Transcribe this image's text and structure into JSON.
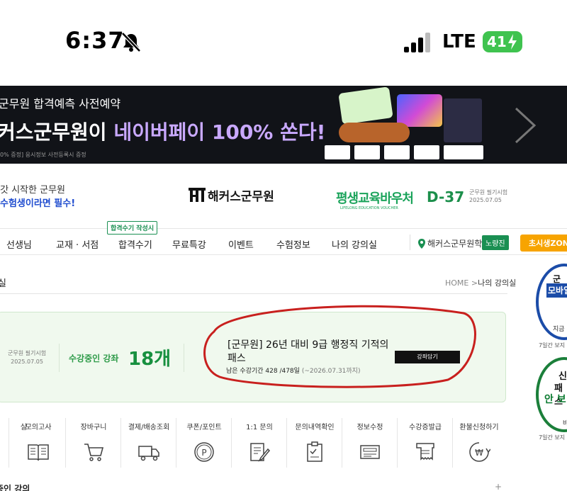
{
  "statusbar": {
    "time": "6:37",
    "network": "LTE",
    "battery": "41"
  },
  "banner": {
    "top_line": "군무원 합격예측 사전예약",
    "main_prefix": "커스군무원이 ",
    "main_highlight": "네이버페이 100% 쏜다!",
    "fine_print": "0% 증정] 응시정보 사전등록시 증정"
  },
  "header": {
    "tagline_1": "갓 시작한 군무원",
    "tagline_2": "수험생이라면 필수!",
    "logo_text": "해커스군무원",
    "voucher_title": "평생교육바우처",
    "voucher_sub": "LIFELONG EDUCATION VOUCHER",
    "dday": "D-37",
    "dday_info_1": "군무원 필기시험",
    "dday_info_2": "2025.07.05"
  },
  "nav": {
    "items": [
      "선생님",
      "교재 · 서점",
      "합격수기",
      "무료특강",
      "이벤트",
      "수험정보",
      "나의 강의실"
    ],
    "badge": "합격수기 작성시",
    "place": "해커스군무원학원",
    "place_button": "노량진",
    "zone_button": "초시생ZONE"
  },
  "page": {
    "title": "실",
    "breadcrumb_home": "HOME",
    "breadcrumb_sep": ">",
    "breadcrumb_current": "나의 강의실"
  },
  "summary": {
    "exam_label": "군무원 필기시험",
    "exam_date": "2025.07.05",
    "active_label": "수강중인 강좌",
    "active_count": "18개",
    "course_title": "[군무원] 26년 대비 9급 행정직 기적의 패스",
    "remain_label": "남은 수강기간 428 /478일",
    "remain_until": "(~2026.07.31까지)",
    "basket_button": "강좌담기"
  },
  "side_ads": {
    "ad1_line1": "군무",
    "ad1_line2": "모바일",
    "ad1_line3": "지금",
    "ad1_caption": "7일간 보지 않",
    "ad2_line1": "신",
    "ad2_line2": "패스",
    "ad2_line3": "안 보",
    "ad2_line4": "바",
    "ad2_caption": "7일간 보지 않"
  },
  "quick_menu": [
    {
      "label": "실",
      "icon": "none"
    },
    {
      "label": "모의고사",
      "icon": "book-icon"
    },
    {
      "label": "장바구니",
      "icon": "cart-icon"
    },
    {
      "label": "결제/배송조회",
      "icon": "truck-icon"
    },
    {
      "label": "쿠폰/포인트",
      "icon": "coupon-icon"
    },
    {
      "label": "1:1 문의",
      "icon": "pencil-note-icon"
    },
    {
      "label": "문의내역확인",
      "icon": "checklist-icon"
    },
    {
      "label": "정보수정",
      "icon": "id-card-icon"
    },
    {
      "label": "수강증발급",
      "icon": "receipt-icon"
    },
    {
      "label": "환불신청하기",
      "icon": "won-coin-icon"
    }
  ],
  "bottom": {
    "section_title": "중인 강의",
    "plus": "+"
  },
  "colors": {
    "brand_green": "#17903f",
    "summary_bg": "#f0f9ee",
    "banner_bg": "#111318",
    "circle_red": "#c8201e"
  }
}
